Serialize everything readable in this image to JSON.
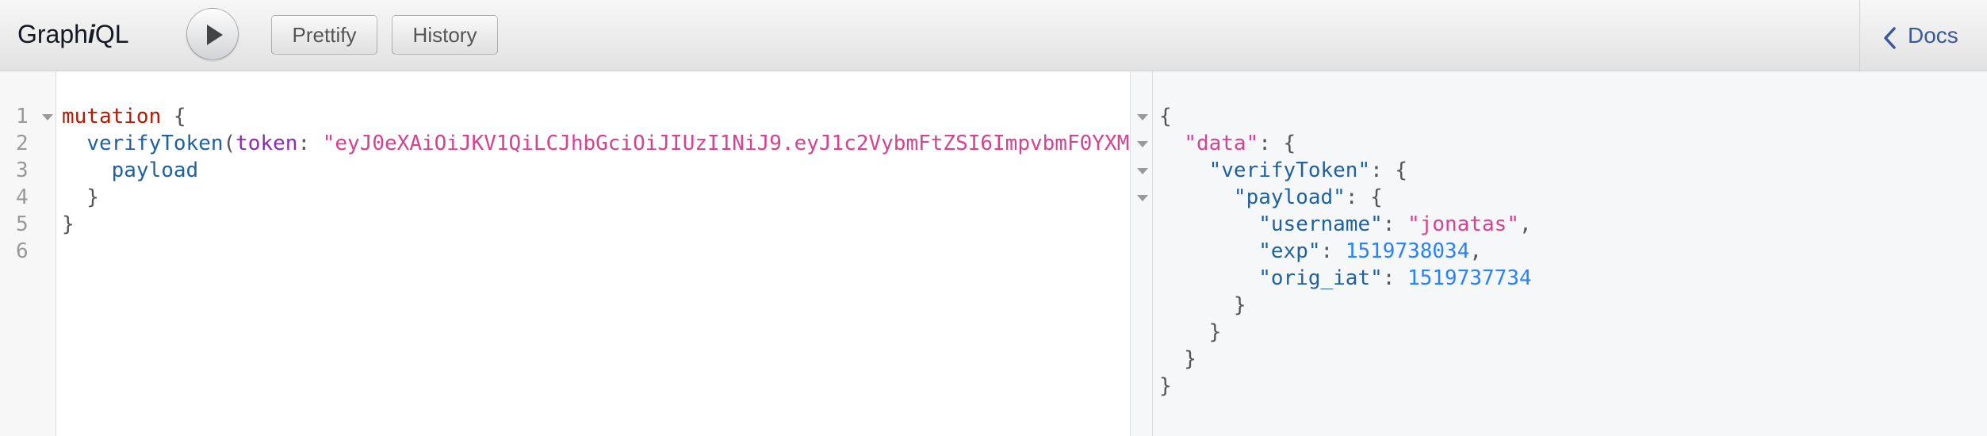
{
  "app": {
    "title_prefix": "Graph",
    "title_italic": "i",
    "title_suffix": "QL"
  },
  "toolbar": {
    "prettify_label": "Prettify",
    "history_label": "History"
  },
  "docs": {
    "label": "Docs"
  },
  "editor": {
    "line_numbers": [
      "1",
      "2",
      "3",
      "4",
      "5",
      "6"
    ],
    "tokens": {
      "mutation_kw": "mutation",
      "open_brace": " {",
      "indent2": "  ",
      "field_verify": "verifyToken",
      "paren_open": "(",
      "arg_token": "token",
      "colon": ": ",
      "token_value": "\"eyJ0eXAiOiJKV1QiLCJhbGciOiJIUzI1NiJ9.eyJ1c2VybmFtZSI6ImpvbmF0YXM",
      "indent4": "    ",
      "field_payload": "payload",
      "close_brace_indented": "  }",
      "close_brace": "}"
    }
  },
  "result": {
    "lines": {
      "l1": "{",
      "l2_indent": "  ",
      "l2_key": "\"data\"",
      "l2_rest": ": {",
      "l3_indent": "    ",
      "l3_key": "\"verifyToken\"",
      "l3_rest": ": {",
      "l4_indent": "      ",
      "l4_key": "\"payload\"",
      "l4_rest": ": {",
      "l5_indent": "        ",
      "l5_key": "\"username\"",
      "l5_colon": ": ",
      "l5_value": "\"jonatas\"",
      "l5_comma": ",",
      "l6_indent": "        ",
      "l6_key": "\"exp\"",
      "l6_colon": ": ",
      "l6_value": "1519738034",
      "l6_comma": ",",
      "l7_indent": "        ",
      "l7_key": "\"orig_iat\"",
      "l7_colon": ": ",
      "l7_value": "1519737734",
      "l8": "      }",
      "l9": "    }",
      "l10": "  }",
      "l11": "}"
    }
  },
  "colors": {
    "keyword": "#b11a04",
    "field": "#1f61a0",
    "argument": "#8b2bb9",
    "string": "#d64292",
    "number": "#2882f9",
    "docs_link": "#3b5998"
  }
}
